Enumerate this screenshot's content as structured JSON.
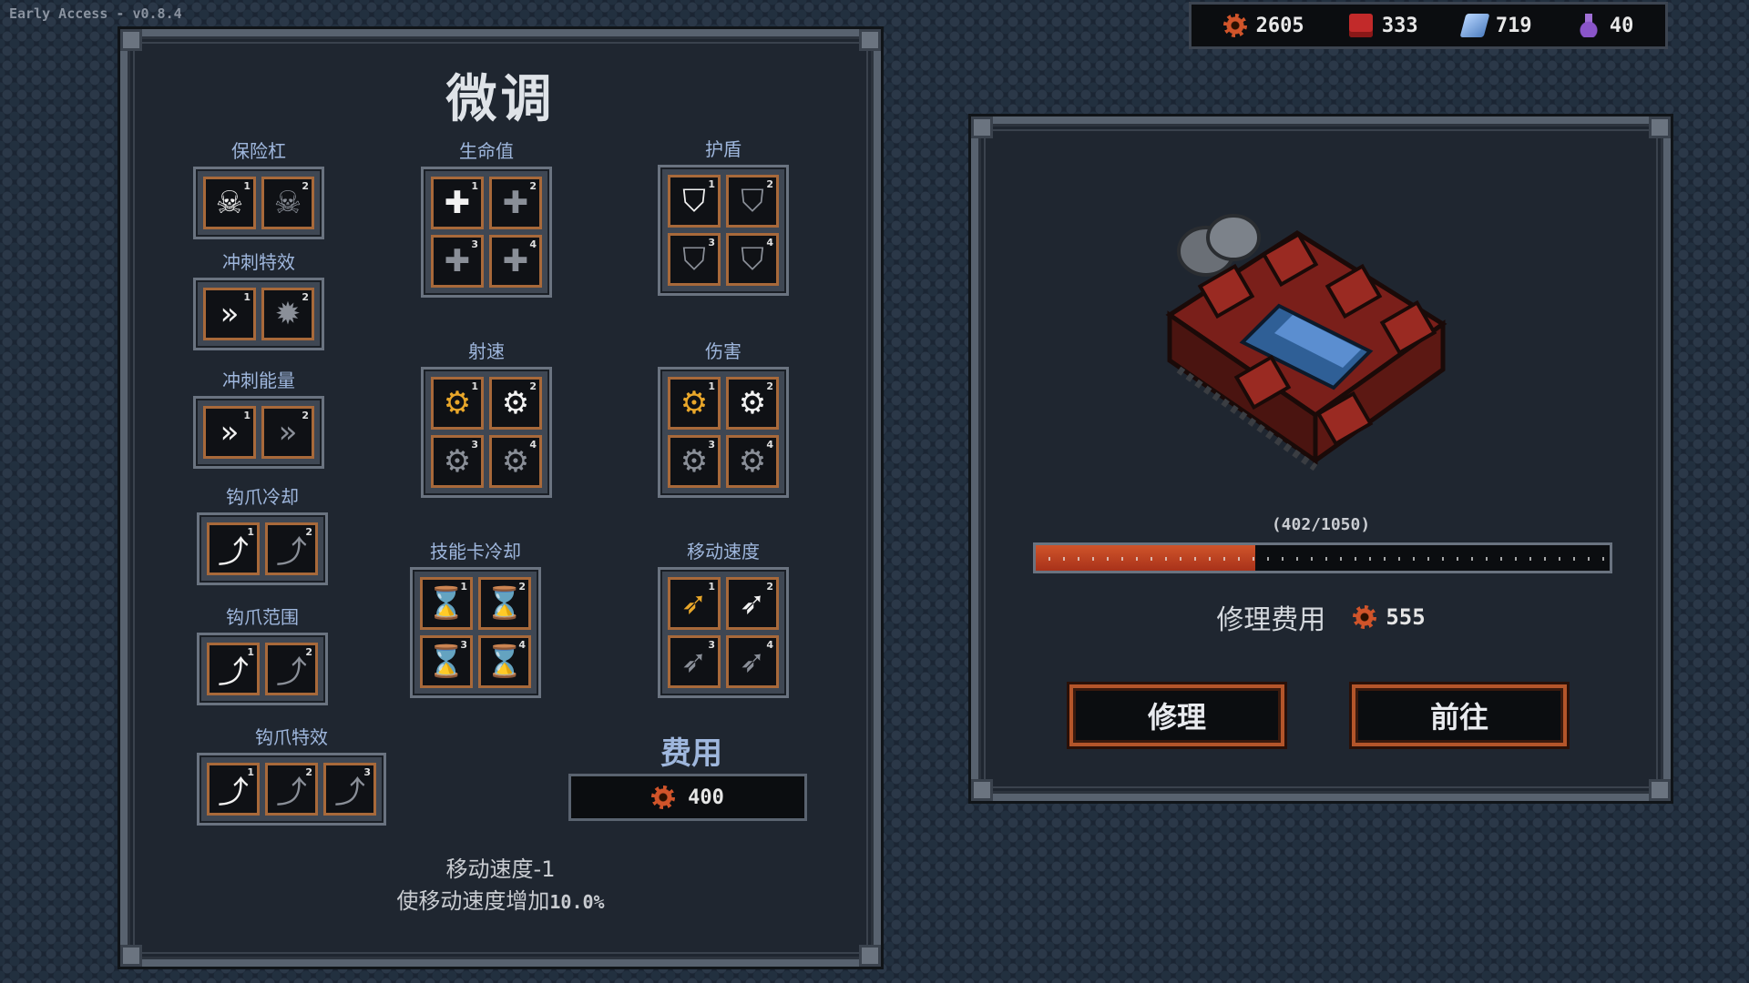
{
  "version": "Early Access - v0.8.4",
  "resources": [
    {
      "icon": "gear-icon",
      "value": "2605"
    },
    {
      "icon": "red-box-icon",
      "value": "333"
    },
    {
      "icon": "crystal-icon",
      "value": "719"
    },
    {
      "icon": "potion-icon",
      "value": "40"
    }
  ],
  "tuning": {
    "title": "微调",
    "groups": {
      "bumper": {
        "label": "保险杠",
        "slots": [
          "1",
          "2"
        ]
      },
      "dash_effect": {
        "label": "冲刺特效",
        "slots": [
          "1",
          "2"
        ]
      },
      "dash_energy": {
        "label": "冲刺能量",
        "slots": [
          "1",
          "2"
        ]
      },
      "hook_cooldown": {
        "label": "钩爪冷却",
        "slots": [
          "1",
          "2"
        ]
      },
      "hook_range": {
        "label": "钩爪范围",
        "slots": [
          "1",
          "2"
        ]
      },
      "hook_effect": {
        "label": "钩爪特效",
        "slots": [
          "1",
          "2",
          "3"
        ]
      },
      "health": {
        "label": "生命值",
        "slots": [
          "1",
          "2",
          "3",
          "4"
        ]
      },
      "fire_rate": {
        "label": "射速",
        "slots": [
          "1",
          "2",
          "3",
          "4"
        ]
      },
      "skill_cooldown": {
        "label": "技能卡冷却",
        "slots": [
          "1",
          "2",
          "3",
          "4"
        ]
      },
      "shield": {
        "label": "护盾",
        "slots": [
          "1",
          "2",
          "3",
          "4"
        ]
      },
      "damage": {
        "label": "伤害",
        "slots": [
          "1",
          "2",
          "3",
          "4"
        ]
      },
      "move_speed": {
        "label": "移动速度",
        "slots": [
          "1",
          "2",
          "3",
          "4"
        ]
      }
    },
    "cost_label": "费用",
    "cost_value": "400",
    "desc_line1": "移动速度-1",
    "desc_line2_prefix": "使移动速度增加",
    "desc_line2_value": "10.0%"
  },
  "vehicle": {
    "hp_text": "(402/1050)",
    "hp_fraction": 0.383,
    "repair_cost_label": "修理费用",
    "repair_cost_value": "555",
    "repair_button": "修理",
    "go_button": "前往"
  },
  "colors": {
    "accent": "#d0542a",
    "label_blue": "#9fb7dd",
    "slot_border": "#a8693a"
  }
}
